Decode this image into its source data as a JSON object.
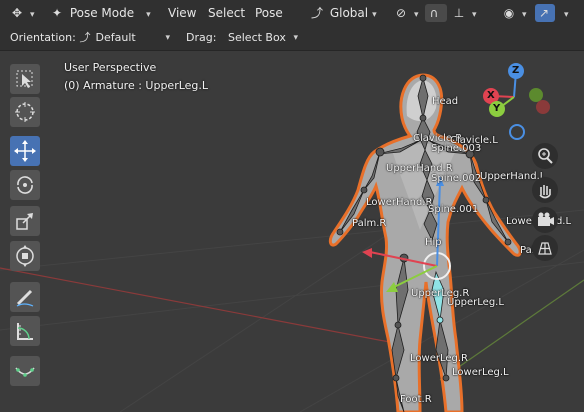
{
  "header": {
    "mode": "Pose Mode",
    "menus": [
      "View",
      "Select",
      "Pose"
    ],
    "transform_orientation": "Global",
    "icons": [
      "editor-type-icon",
      "mode-icon",
      "orientation-icon",
      "pivot-icon",
      "snap-icon",
      "snap-element-icon",
      "visibility-icon",
      "gizmo-icon"
    ]
  },
  "toolheader": {
    "orientation_label": "Orientation:",
    "orientation_value": "Default",
    "drag_label": "Drag:",
    "drag_value": "Select Box"
  },
  "viewport": {
    "view_name": "User Perspective",
    "object_info": "(0) Armature : UpperLeg.L",
    "gizmo_axes": [
      "Z",
      "X",
      "Y"
    ],
    "bone_labels": [
      "Head",
      "Clavicle.R",
      "Clavicle.L",
      "Spine.003",
      "UpperHand.R",
      "UpperHand.L",
      "Spine.002",
      "LowerHand.R",
      "Spine.001",
      "LowerHand.L",
      "Palm.R",
      "Palm.L",
      "Hip",
      "UpperLeg.R",
      "UpperLeg.L",
      "LowerLeg.R",
      "LowerLeg.L",
      "Foot.R"
    ]
  },
  "toolbar": {
    "tools": [
      "select-box",
      "cursor",
      "move",
      "rotate",
      "scale",
      "transform",
      "annotate",
      "measure",
      "relax"
    ],
    "active": "move"
  },
  "colors": {
    "active_tool": "#4772b3",
    "selection_outline": "#e8702a",
    "bone_active": "#8fe3e6",
    "axis_x": "#e04351",
    "axis_y": "#8ccd3f",
    "axis_z": "#4a8fe3"
  }
}
